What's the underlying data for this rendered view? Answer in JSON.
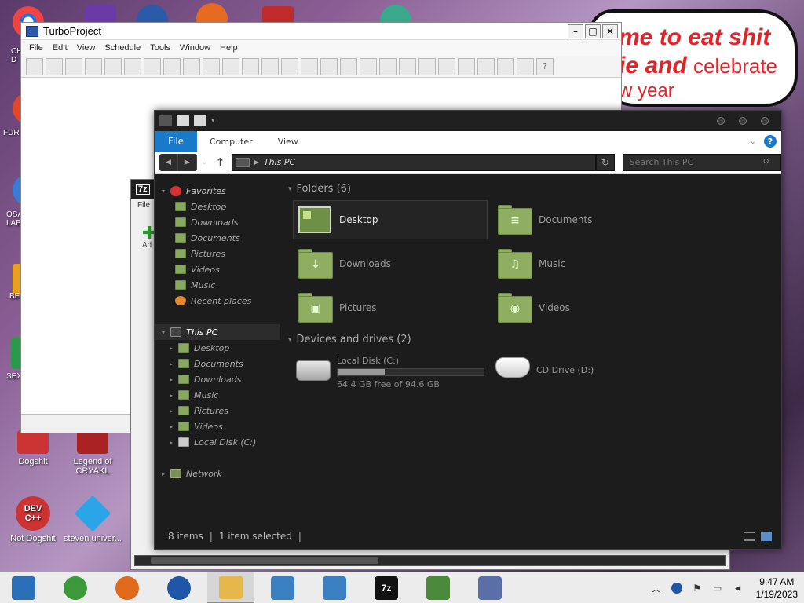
{
  "wallpaper": {
    "meme_lines": [
      "me to eat shit",
      "ie and",
      "celebrate",
      "w year"
    ]
  },
  "desktop": {
    "edge_labels": [
      "CH\nD",
      "FUR",
      "OSA\nLAB",
      "BE",
      "SEX"
    ],
    "icons": [
      {
        "label": "Dogshit",
        "icon": "dev-cpp-icon",
        "color": "#c33"
      },
      {
        "label": "Legend of CRYAKL",
        "icon": "demon-icon",
        "color": "#a22"
      },
      {
        "label": "Not Dogshit",
        "icon": "dev-cpp-icon",
        "color": "#c33",
        "glyph": "DEV\nC++"
      },
      {
        "label": "steven univer...",
        "icon": "diamond-icon",
        "color": "#2aa6e8"
      }
    ]
  },
  "turboproject": {
    "title": "TurboProject",
    "menu": [
      "File",
      "Edit",
      "View",
      "Schedule",
      "Tools",
      "Window",
      "Help"
    ],
    "tool_count": 27,
    "help_glyph": "?"
  },
  "sevenzip": {
    "logo": "7z",
    "menu": "File",
    "add_label": "Ad"
  },
  "explorer": {
    "ribbon": {
      "file": "File",
      "tabs": [
        "Computer",
        "View"
      ],
      "help": "?"
    },
    "address": "This PC",
    "search_placeholder": "Search This PC",
    "nav": {
      "favorites_label": "Favorites",
      "favorites": [
        "Desktop",
        "Downloads",
        "Documents",
        "Pictures",
        "Videos",
        "Music",
        "Recent places"
      ],
      "thispc_label": "This PC",
      "thispc": [
        "Desktop",
        "Documents",
        "Downloads",
        "Music",
        "Pictures",
        "Videos",
        "Local Disk (C:)"
      ],
      "network_label": "Network"
    },
    "folders_header": "Folders (6)",
    "folders": [
      {
        "name": "Desktop",
        "icon": "desktop-folder-icon",
        "selected": true
      },
      {
        "name": "Documents",
        "icon": "documents-folder-icon",
        "glyph": "≡"
      },
      {
        "name": "Downloads",
        "icon": "downloads-folder-icon",
        "glyph": "↓"
      },
      {
        "name": "Music",
        "icon": "music-folder-icon",
        "glyph": "♫"
      },
      {
        "name": "Pictures",
        "icon": "pictures-folder-icon",
        "glyph": "▣"
      },
      {
        "name": "Videos",
        "icon": "videos-folder-icon",
        "glyph": "◉"
      }
    ],
    "devices_header": "Devices and drives (2)",
    "drives": [
      {
        "name": "Local Disk (C:)",
        "free": "64.4 GB free of 94.6 GB",
        "used_fraction": 0.32
      },
      {
        "name": "CD Drive (D:)"
      }
    ],
    "status": {
      "items": "8 items",
      "selected": "1 item selected"
    }
  },
  "taskbar": {
    "items": [
      {
        "name": "photos",
        "icon": "photos-icon",
        "color": "#2a6fb8"
      },
      {
        "name": "chrome",
        "icon": "chrome-icon",
        "color": "#3a9a3a"
      },
      {
        "name": "firefox",
        "icon": "firefox-icon",
        "color": "#e06a1c"
      },
      {
        "name": "obama",
        "icon": "obama-logo-icon",
        "color": "#1f56a8"
      },
      {
        "name": "explorer",
        "icon": "folder-icon",
        "color": "#e6b84a"
      },
      {
        "name": "setup1",
        "icon": "setup-icon",
        "color": "#3a7fc2"
      },
      {
        "name": "setup2",
        "icon": "setup-icon",
        "color": "#3a7fc2"
      },
      {
        "name": "7zip",
        "icon": "7zip-icon",
        "color": "#111",
        "glyph": "7z"
      },
      {
        "name": "installer",
        "icon": "installer-icon",
        "color": "#4a8a3a"
      },
      {
        "name": "vs",
        "icon": "visual-studio-icon",
        "color": "#5a6fa8"
      }
    ],
    "time": "9:47 AM",
    "date": "1/19/2023"
  }
}
